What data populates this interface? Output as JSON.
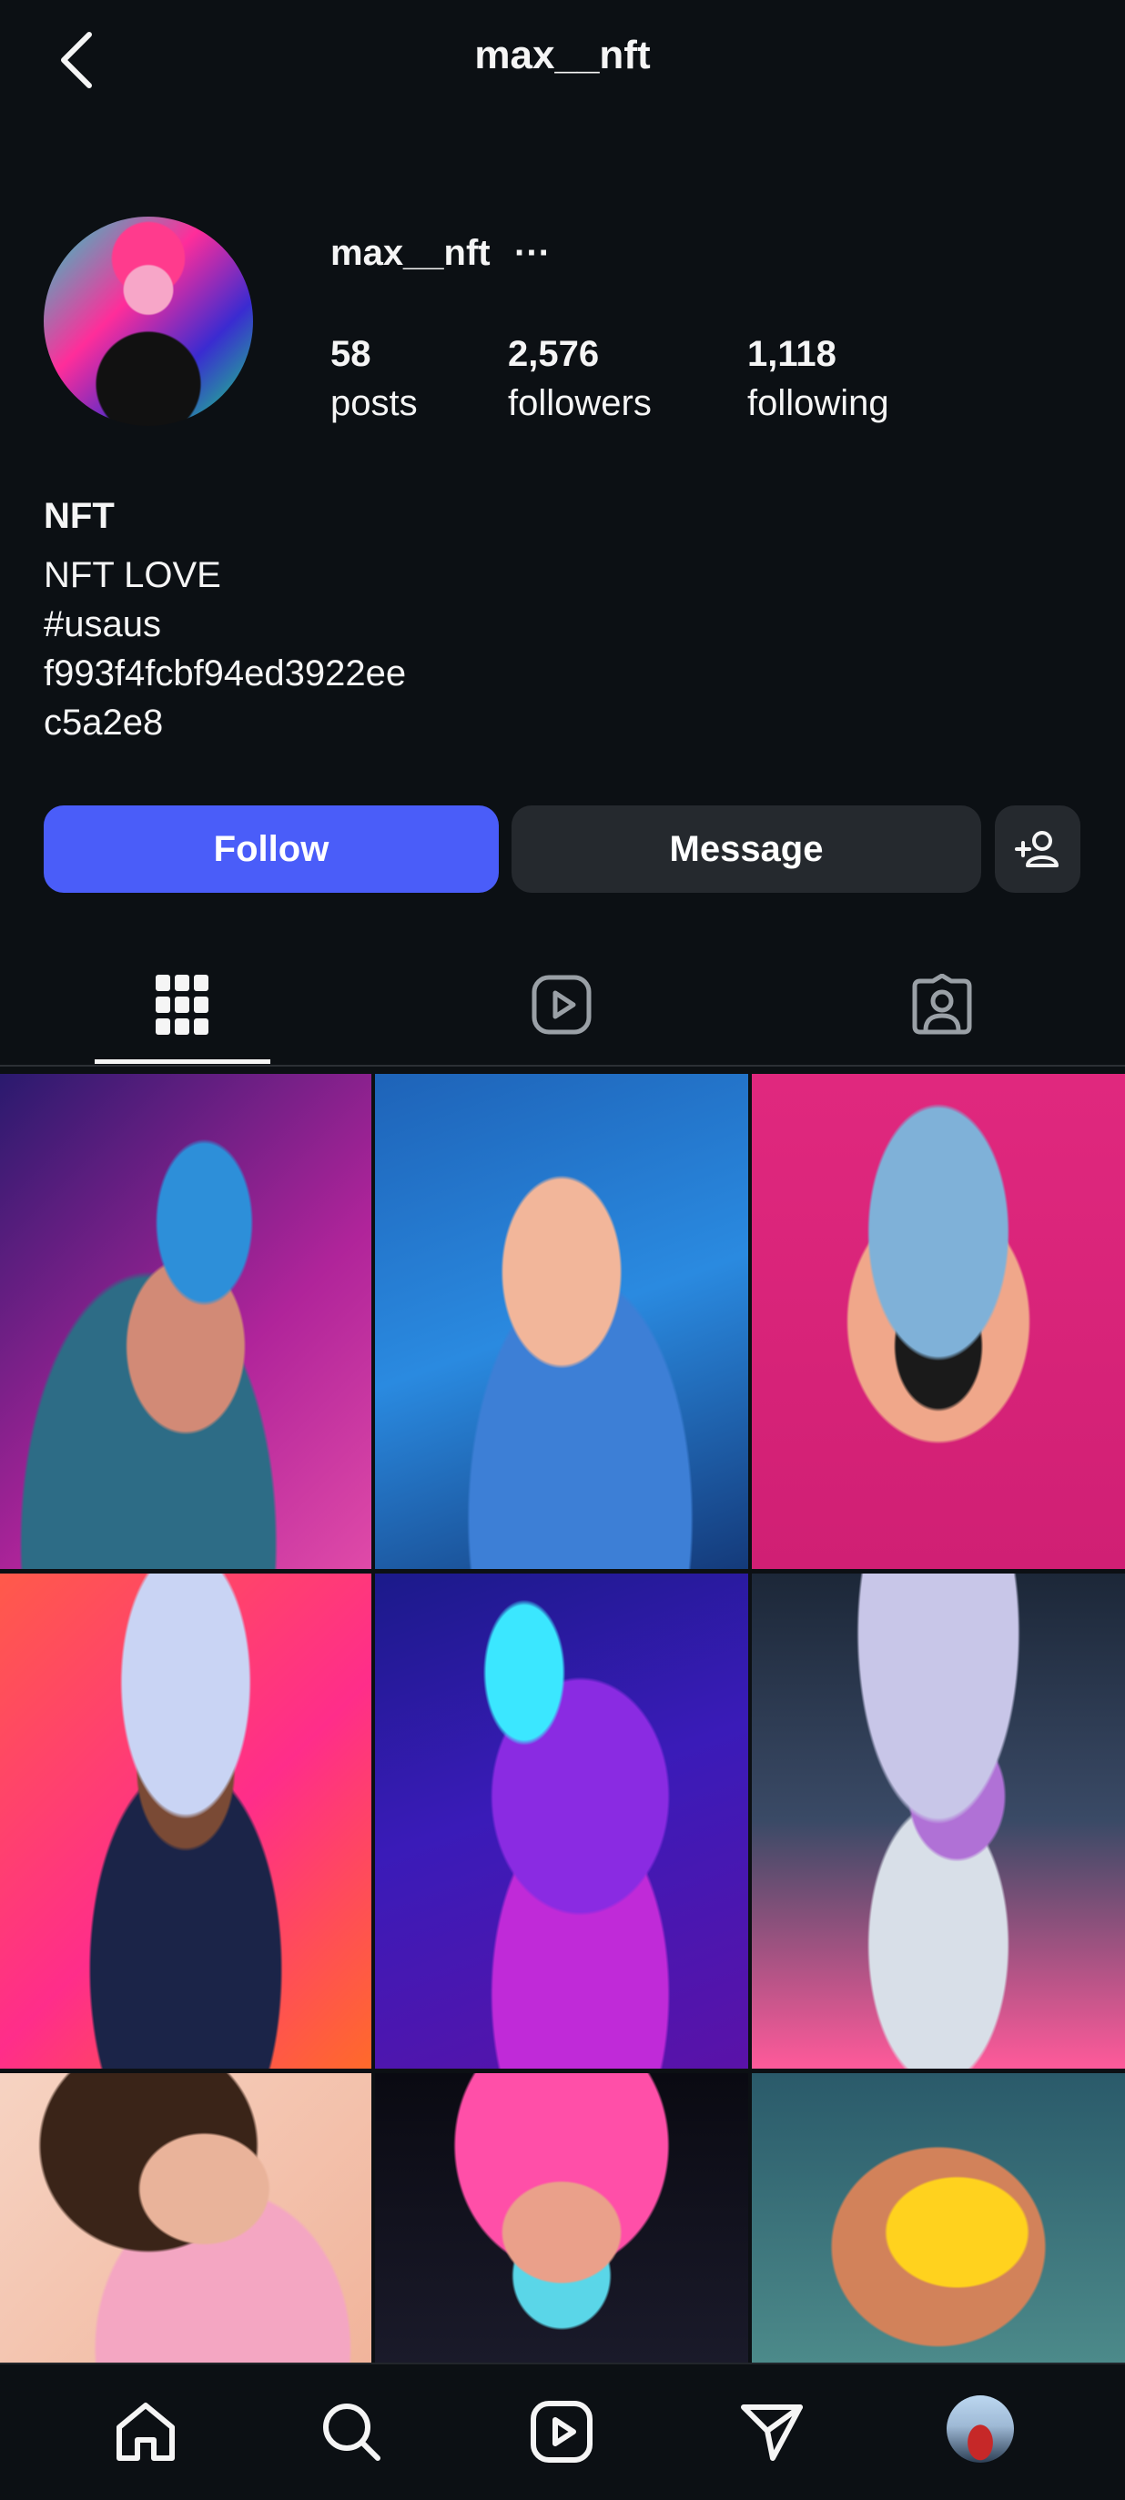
{
  "header": {
    "title": "max__nft",
    "back_icon": "chevron-left-icon"
  },
  "profile": {
    "username": "max__nft",
    "more_label": "···",
    "stats": {
      "posts": {
        "value": "58",
        "label": "posts"
      },
      "followers": {
        "value": "2,576",
        "label": "followers"
      },
      "following": {
        "value": "1,118",
        "label": "following"
      }
    },
    "bio": {
      "name": "NFT",
      "lines": [
        "NFT LOVE",
        "#usaus",
        "f993f4fcbf94ed3922ee",
        "c5a2e8"
      ]
    }
  },
  "actions": {
    "follow_label": "Follow",
    "message_label": "Message",
    "add_person_icon": "add-person-icon"
  },
  "tabs": [
    {
      "name": "grid",
      "icon": "grid-icon",
      "selected": true
    },
    {
      "name": "reels",
      "icon": "reels-icon",
      "selected": false
    },
    {
      "name": "tagged",
      "icon": "tagged-icon",
      "selected": false
    }
  ],
  "bottom_nav": [
    "home-icon",
    "search-icon",
    "reels-icon",
    "send-icon",
    "profile-avatar"
  ],
  "colors": {
    "background": "#0c1014",
    "follow_button": "#4a5df9",
    "secondary_button": "#25292e",
    "text": "#f5f5f5"
  }
}
